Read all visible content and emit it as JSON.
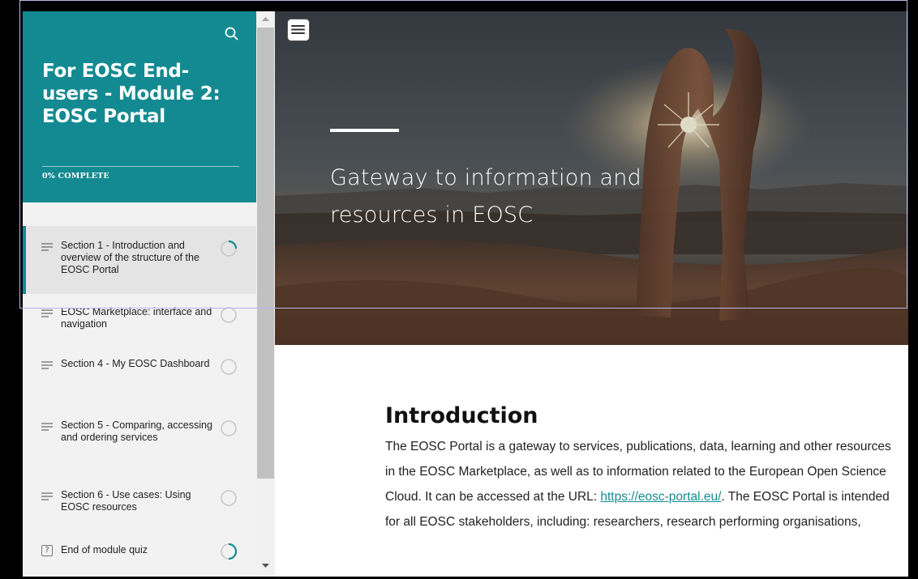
{
  "sidebar": {
    "course_title": "For EOSC End-users - Module 2: EOSC Portal",
    "progress_label": "0% COMPLETE",
    "lessons": [
      {
        "label": "Section 1 - Introduction and overview of the structure of the EOSC Portal",
        "status": "in-progress",
        "active": true
      },
      {
        "label": "EOSC Marketplace: interface and navigation",
        "status": "not-started",
        "active": false
      },
      {
        "label": "Section 4 - My EOSC Dashboard",
        "status": "not-started",
        "active": false
      },
      {
        "label": "Section 5 - Comparing, accessing and ordering services",
        "status": "not-started",
        "active": false
      },
      {
        "label": "Section 6 - Use cases: Using EOSC resources",
        "status": "not-started",
        "active": false
      },
      {
        "label": "End of module quiz",
        "status": "in-progress",
        "active": false,
        "type": "quiz"
      }
    ],
    "quiz_icon_glyph": "?"
  },
  "hero": {
    "title": "Gateway to information and resources in EOSC"
  },
  "content": {
    "heading": "Introduction",
    "paragraph_before_link": "The EOSC Portal is a gateway to services, publications, data, learning and other resources in the EOSC Marketplace, as well as to information related to the European Open Science Cloud. It can be accessed at the URL: ",
    "link_text": "https://eosc-portal.eu/",
    "paragraph_after_link": ". The EOSC Portal is intended for all EOSC stakeholders, including: researchers, research performing organisations,"
  },
  "colors": {
    "brand_teal": "#138a91",
    "status_ring": "#c8c8c8"
  },
  "icons": {
    "search": "search-icon",
    "menu": "hamburger-menu-icon",
    "lesson": "text-lines-icon",
    "quiz": "question-box-icon",
    "status_in_progress": "progress-ring-icon",
    "status_not_started": "empty-circle-icon"
  }
}
